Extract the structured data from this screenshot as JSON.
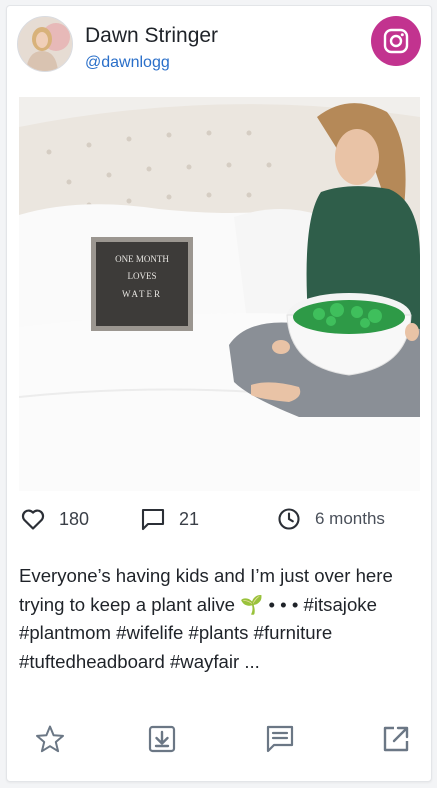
{
  "post": {
    "author_name": "Dawn Stringer",
    "author_handle": "@dawnlogg",
    "platform_icon": "instagram-icon",
    "photo": {
      "letterboard": [
        "ONE MONTH",
        "LOVES",
        "WATER"
      ]
    },
    "likes": "180",
    "comments": "21",
    "age": "6 months",
    "caption": "Everyone’s having kids and I’m just over here trying to keep a plant alive 🌱 • • • #itsajoke #plantmom #wifelife #plants #furniture #tuftedheadboard #wayfair ...",
    "actions": [
      "star-icon",
      "download-icon",
      "comment-icon",
      "external-link-icon"
    ]
  },
  "colors": {
    "instagram_badge": "#c2338f",
    "handle": "#2a6fc9",
    "icon_gray": "#6b7785"
  }
}
